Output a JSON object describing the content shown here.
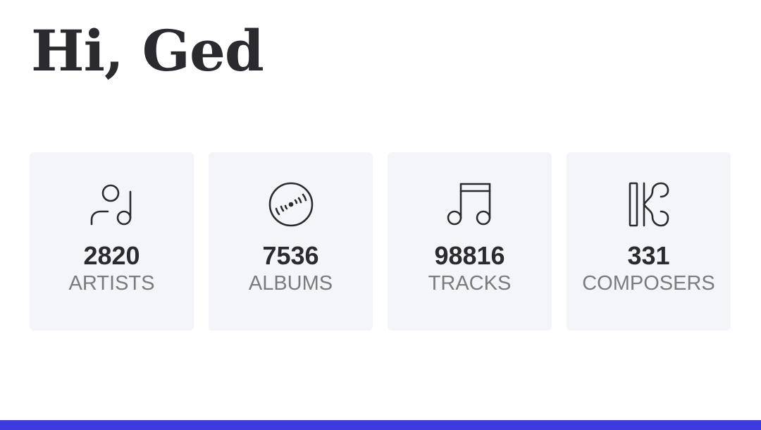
{
  "greeting": "Hi, Ged",
  "stats": [
    {
      "icon": "artist-icon",
      "count": "2820",
      "label": "ARTISTS"
    },
    {
      "icon": "album-icon",
      "count": "7536",
      "label": "ALBUMS"
    },
    {
      "icon": "track-icon",
      "count": "98816",
      "label": "TRACKS"
    },
    {
      "icon": "composer-icon",
      "count": "331",
      "label": "COMPOSERS"
    }
  ],
  "colors": {
    "text": "#2b2b2f",
    "muted": "#7a7a80",
    "card_background": "#f4f5f9",
    "accent": "#3d3ae0"
  }
}
